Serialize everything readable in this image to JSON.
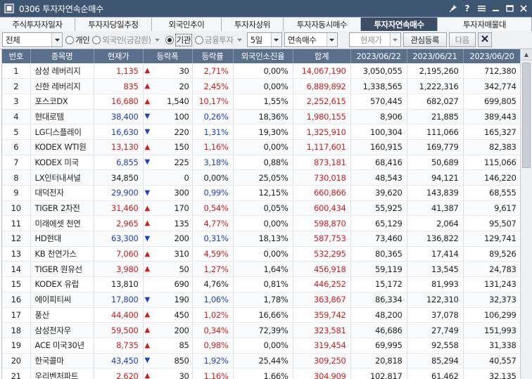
{
  "window": {
    "title": "0306 투자자연속순매수"
  },
  "tabs": [
    {
      "label": "주식투자자일자",
      "active": false
    },
    {
      "label": "투자자당일추정",
      "active": false
    },
    {
      "label": "외국인추이",
      "active": false
    },
    {
      "label": "투자자상위",
      "active": false
    },
    {
      "label": "투자자동시매수",
      "active": false
    },
    {
      "label": "투자자연속매수",
      "active": true
    },
    {
      "label": "투자자매물대",
      "active": false
    }
  ],
  "toolbar": {
    "market": "전체",
    "radio_individual": "개인",
    "radio_foreign": "외국인(금감원)",
    "radio_institution": "기관",
    "radio_financial": "금융투자",
    "period": "5일",
    "mode": "연속매수",
    "price_label": "현재가",
    "watchlist_label": "관심등록",
    "next_label": "다음"
  },
  "table": {
    "headers": [
      "번호",
      "종목명",
      "현재가",
      "등락폭",
      "등락률",
      "외국인소진율",
      "합계",
      "2023/06/22",
      "2023/06/21",
      "2023/06/20"
    ],
    "rows": [
      {
        "no": "1",
        "name": "삼성 레버리지",
        "price": "1,135",
        "dir": "up",
        "chg": "30",
        "rate": "2,71%",
        "foreign": "0,00%",
        "total": "14,067,190",
        "d1": "3,050,055",
        "d2": "2,195,260",
        "d3": "712,380"
      },
      {
        "no": "2",
        "name": "신한 레버리지",
        "price": "835",
        "dir": "up",
        "chg": "20",
        "rate": "2,45%",
        "foreign": "0,00%",
        "total": "6,889,892",
        "d1": "1,338,565",
        "d2": "1,222,316",
        "d3": "342,774"
      },
      {
        "no": "3",
        "name": "포스코DX",
        "price": "16,680",
        "dir": "up",
        "chg": "1,540",
        "rate": "10,17%",
        "foreign": "1,55%",
        "total": "2,252,615",
        "d1": "570,445",
        "d2": "682,027",
        "d3": "699,805"
      },
      {
        "no": "4",
        "name": "현대로템",
        "price": "38,400",
        "dir": "down",
        "chg": "100",
        "rate": "0,26%",
        "foreign": "18,36%",
        "total": "1,980,155",
        "d1": "8,906",
        "d2": "21,885",
        "d3": "389,443"
      },
      {
        "no": "5",
        "name": "LG디스플레이",
        "price": "16,630",
        "dir": "down",
        "chg": "220",
        "rate": "1,31%",
        "foreign": "19,30%",
        "total": "1,325,910",
        "d1": "100,304",
        "d2": "111,066",
        "d3": "165,327"
      },
      {
        "no": "6",
        "name": "KODEX WTI원",
        "price": "13,130",
        "dir": "up",
        "chg": "150",
        "rate": "1,16%",
        "foreign": "0,00%",
        "total": "1,117,601",
        "d1": "160,915",
        "d2": "169,779",
        "d3": "82,383"
      },
      {
        "no": "7",
        "name": "KODEX 미국",
        "price": "6,855",
        "dir": "down",
        "chg": "225",
        "rate": "3,18%",
        "foreign": "0,88%",
        "total": "873,181",
        "d1": "68,416",
        "d2": "50,689",
        "d3": "115,066"
      },
      {
        "no": "8",
        "name": "LX인터내셔널",
        "price": "34,850",
        "dir": "flat",
        "chg": "0",
        "rate": "0,00%",
        "foreign": "25,05%",
        "total": "730,018",
        "d1": "48,543",
        "d2": "94,121",
        "d3": "146,220"
      },
      {
        "no": "9",
        "name": "대덕전자",
        "price": "29,900",
        "dir": "down",
        "chg": "300",
        "rate": "0,99%",
        "foreign": "12,15%",
        "total": "660,866",
        "d1": "39,620",
        "d2": "143,839",
        "d3": "68,555"
      },
      {
        "no": "10",
        "name": "TIGER 2차전",
        "price": "31,460",
        "dir": "up",
        "chg": "170",
        "rate": "0,54%",
        "foreign": "0,05%",
        "total": "600,434",
        "d1": "55,925",
        "d2": "41,387",
        "d3": "9,617"
      },
      {
        "no": "11",
        "name": "미래에셋 천연",
        "price": "2,965",
        "dir": "up",
        "chg": "135",
        "rate": "4,77%",
        "foreign": "0,00%",
        "total": "598,870",
        "d1": "65,129",
        "d2": "2,064",
        "d3": "95,507"
      },
      {
        "no": "12",
        "name": "HD현대",
        "price": "63,300",
        "dir": "down",
        "chg": "200",
        "rate": "0,31%",
        "foreign": "18,13%",
        "total": "587,753",
        "d1": "73,460",
        "d2": "136,822",
        "d3": "129,741"
      },
      {
        "no": "13",
        "name": "KB 천연가스",
        "price": "7,060",
        "dir": "up",
        "chg": "310",
        "rate": "4,59%",
        "foreign": "0,00%",
        "total": "532,295",
        "d1": "80,365",
        "d2": "17,414",
        "d3": "89,526"
      },
      {
        "no": "14",
        "name": "TIGER 원유선",
        "price": "3,980",
        "dir": "up",
        "chg": "50",
        "rate": "1,27%",
        "foreign": "1,64%",
        "total": "456,918",
        "d1": "59,119",
        "d2": "13,545",
        "d3": "24,783"
      },
      {
        "no": "15",
        "name": "KODEX 유럽",
        "price": "13,810",
        "dir": "flat",
        "chg": "690",
        "rate": "4,76%",
        "foreign": "0,81%",
        "total": "446,252",
        "d1": "15,172",
        "d2": "81,993",
        "d3": "131,243"
      },
      {
        "no": "16",
        "name": "에이피티씨",
        "price": "17,800",
        "dir": "down",
        "chg": "190",
        "rate": "1,06%",
        "foreign": "1,78%",
        "total": "363,867",
        "d1": "86,334",
        "d2": "122,310",
        "d3": "32,373"
      },
      {
        "no": "17",
        "name": "풍산",
        "price": "44,400",
        "dir": "up",
        "chg": "450",
        "rate": "1,02%",
        "foreign": "16,66%",
        "total": "359,742",
        "d1": "48,200",
        "d2": "37,078",
        "d3": "106,299"
      },
      {
        "no": "18",
        "name": "삼성전자우",
        "price": "59,500",
        "dir": "up",
        "chg": "200",
        "rate": "0,34%",
        "foreign": "72,39%",
        "total": "323,581",
        "d1": "46,686",
        "d2": "27,749",
        "d3": "151,993"
      },
      {
        "no": "19",
        "name": "ACE 미국30년",
        "price": "8,735",
        "dir": "up",
        "chg": "85",
        "rate": "0,98%",
        "foreign": "0,00%",
        "total": "319,454",
        "d1": "69,995",
        "d2": "92,558",
        "d3": "31,338"
      },
      {
        "no": "20",
        "name": "한국콜마",
        "price": "43,450",
        "dir": "down",
        "chg": "850",
        "rate": "1,92%",
        "foreign": "25,44%",
        "total": "309,250",
        "d1": "20,818",
        "d2": "85,294",
        "d3": "40,557"
      },
      {
        "no": "21",
        "name": "우리벤처파트",
        "price": "2,620",
        "dir": "up",
        "chg": "30",
        "rate": "1,16%",
        "foreign": "1,66%",
        "total": "304,909",
        "d1": "102,817",
        "d2": "61,462",
        "d3": "32,135"
      }
    ]
  },
  "colors": {
    "up": "#d01c1c",
    "down": "#1c3fc8",
    "header_bg": "#5a6f8c",
    "titlebar_bg": "#3f5673",
    "active_tab_bg": "#3c4d66"
  },
  "icons": {
    "title": "window-app-icon",
    "pin": "pin-icon",
    "help": "help-icon",
    "menu": "menu-icon",
    "minimize": "minimize-icon",
    "maximize": "maximize-icon",
    "close": "close-icon"
  }
}
